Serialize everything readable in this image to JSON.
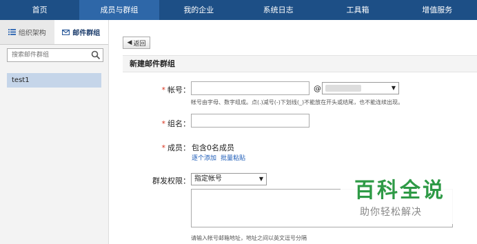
{
  "nav": {
    "items": [
      {
        "label": "首页",
        "active": false
      },
      {
        "label": "成员与群组",
        "active": true
      },
      {
        "label": "我的企业",
        "active": false
      },
      {
        "label": "系统日志",
        "active": false
      },
      {
        "label": "工具箱",
        "active": false
      },
      {
        "label": "增值服务",
        "active": false
      }
    ]
  },
  "sidebar": {
    "tabs": [
      {
        "label": "组织架构",
        "icon": "list-icon",
        "active": false
      },
      {
        "label": "邮件群组",
        "icon": "mail-group-icon",
        "active": true
      }
    ],
    "search_placeholder": "搜索邮件群组",
    "groups": [
      "test1"
    ]
  },
  "main": {
    "back_label": "返回",
    "title": "新建邮件群组",
    "account": {
      "label": "帐号：",
      "at": "@",
      "hint": "帐号由字母、数字组成。点(.)减号(-)下划线(_)不能放在开头或结尾，也不能连续出现。"
    },
    "group_name": {
      "label": "组名："
    },
    "members": {
      "label": "成员：",
      "value": "包含0名成员",
      "add_one": "逐个添加",
      "batch_paste": "批量粘贴"
    },
    "permission": {
      "label": "群发权限：",
      "selected": "指定帐号",
      "hint": "请输入帐号邮箱地址，地址之间以英文逗号分隔"
    }
  },
  "watermark": {
    "title": "百科全说",
    "subtitle": "助你轻松解决"
  },
  "colors": {
    "nav_bg": "#1d4f86",
    "nav_active": "#2e67a8",
    "required": "#d8321c",
    "link": "#1a5ab7",
    "watermark_green": "#2e9a46"
  }
}
